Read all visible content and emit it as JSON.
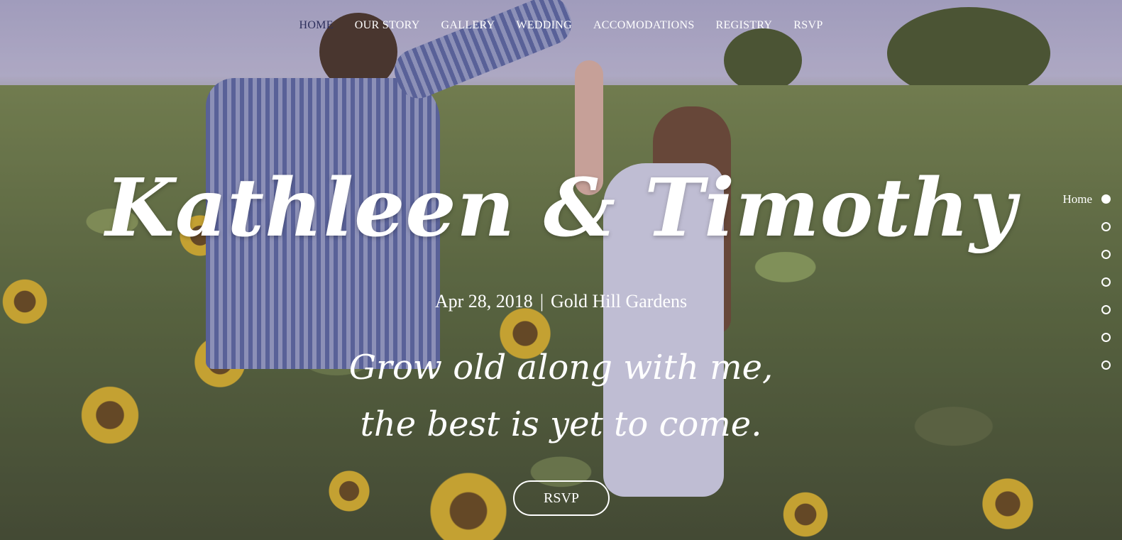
{
  "nav": {
    "items": [
      "HOME",
      "OUR STORY",
      "GALLERY",
      "WEDDING",
      "ACCOMODATIONS",
      "REGISTRY",
      "RSVP"
    ],
    "active_index": 0,
    "active_color": "#2d2f5c"
  },
  "hero": {
    "names": "Kathleen & Timothy",
    "date": "Apr 28, 2018",
    "separator": "|",
    "venue": "Gold Hill Gardens",
    "quote_line1": "Grow old along with me,",
    "quote_line2": "the best is yet to come.",
    "rsvp_label": "RSVP"
  },
  "side_nav": {
    "active_label": "Home",
    "dot_count": 7,
    "active_index": 0
  },
  "colors": {
    "text": "#ffffff",
    "sky": "#c4c0db",
    "foliage": "#5a6a3a",
    "sunflower": "#e0b82a"
  }
}
